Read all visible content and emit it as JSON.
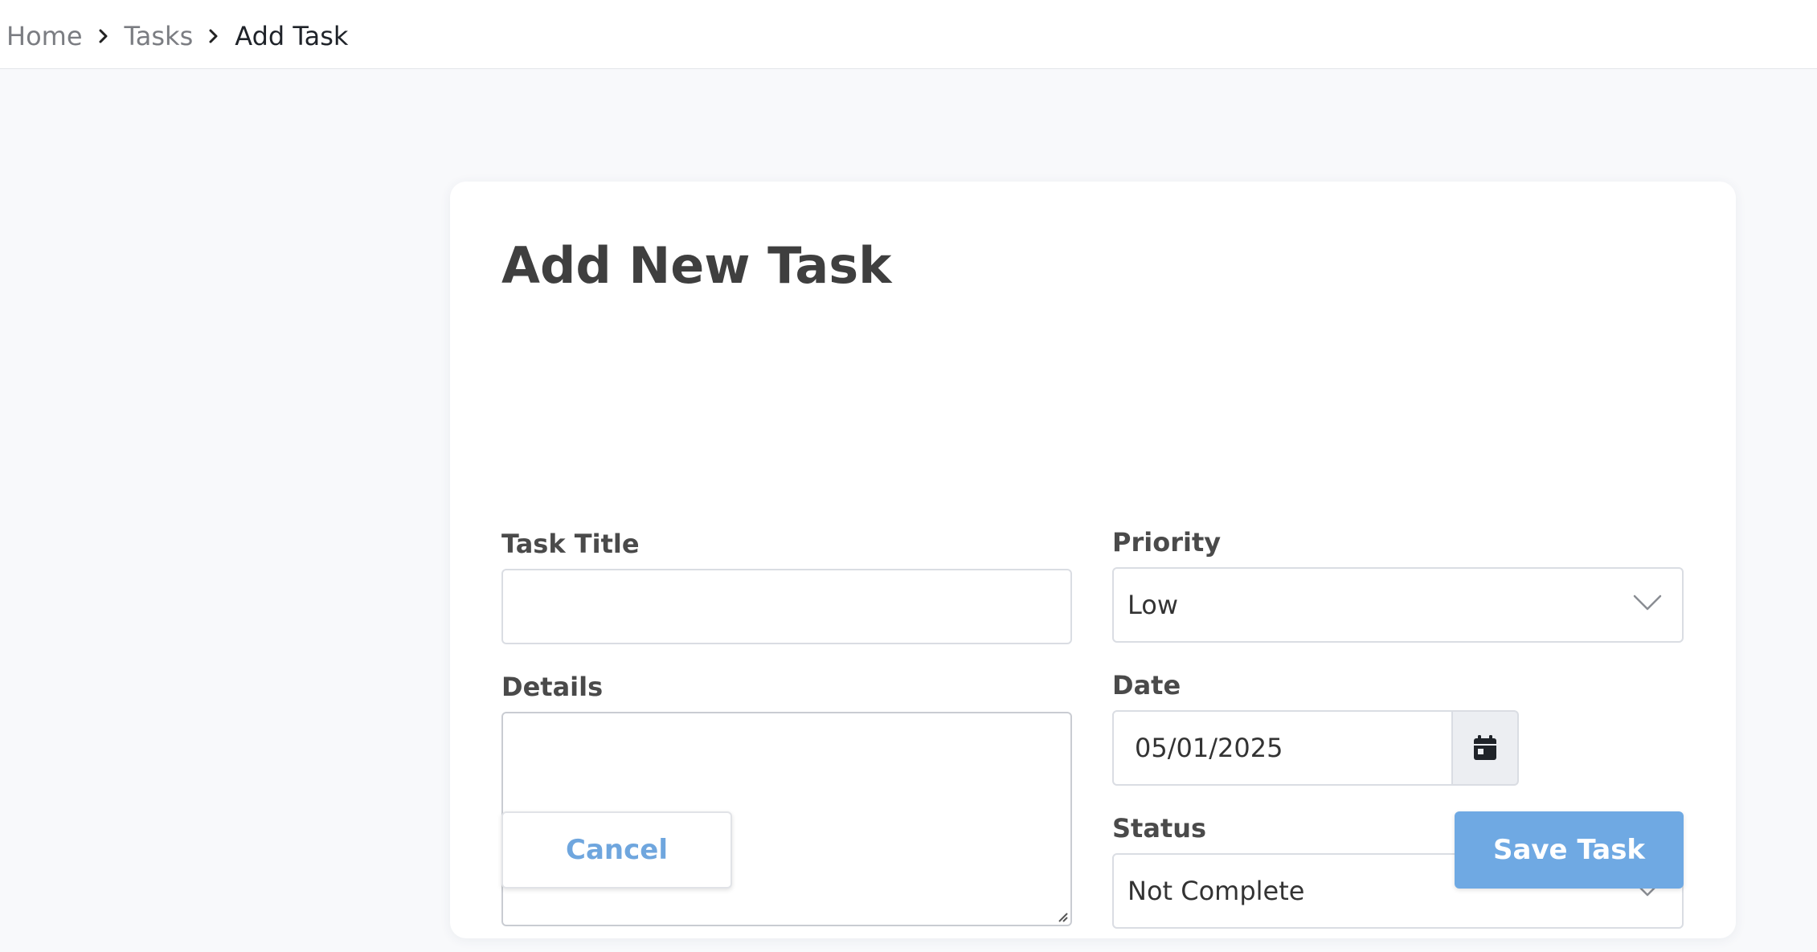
{
  "breadcrumb": {
    "items": [
      {
        "label": "Home"
      },
      {
        "label": "Tasks"
      },
      {
        "label": "Add Task"
      }
    ]
  },
  "form": {
    "title": "Add New Task",
    "task_title": {
      "label": "Task Title",
      "value": "",
      "placeholder": ""
    },
    "details": {
      "label": "Details",
      "value": "",
      "placeholder": ""
    },
    "priority": {
      "label": "Priority",
      "selected": "Low"
    },
    "date": {
      "label": "Date",
      "value": "05/01/2025"
    },
    "status": {
      "label": "Status",
      "selected": "Not Complete"
    },
    "cancel_label": "Cancel",
    "save_label": "Save Task"
  },
  "colors": {
    "accent": "#6fa9e3",
    "page_background": "#f8f9fb"
  },
  "icons": {
    "breadcrumb_separator": "chevron-right-icon",
    "select_arrow": "chevron-down-icon",
    "date_picker": "calendar-icon"
  }
}
